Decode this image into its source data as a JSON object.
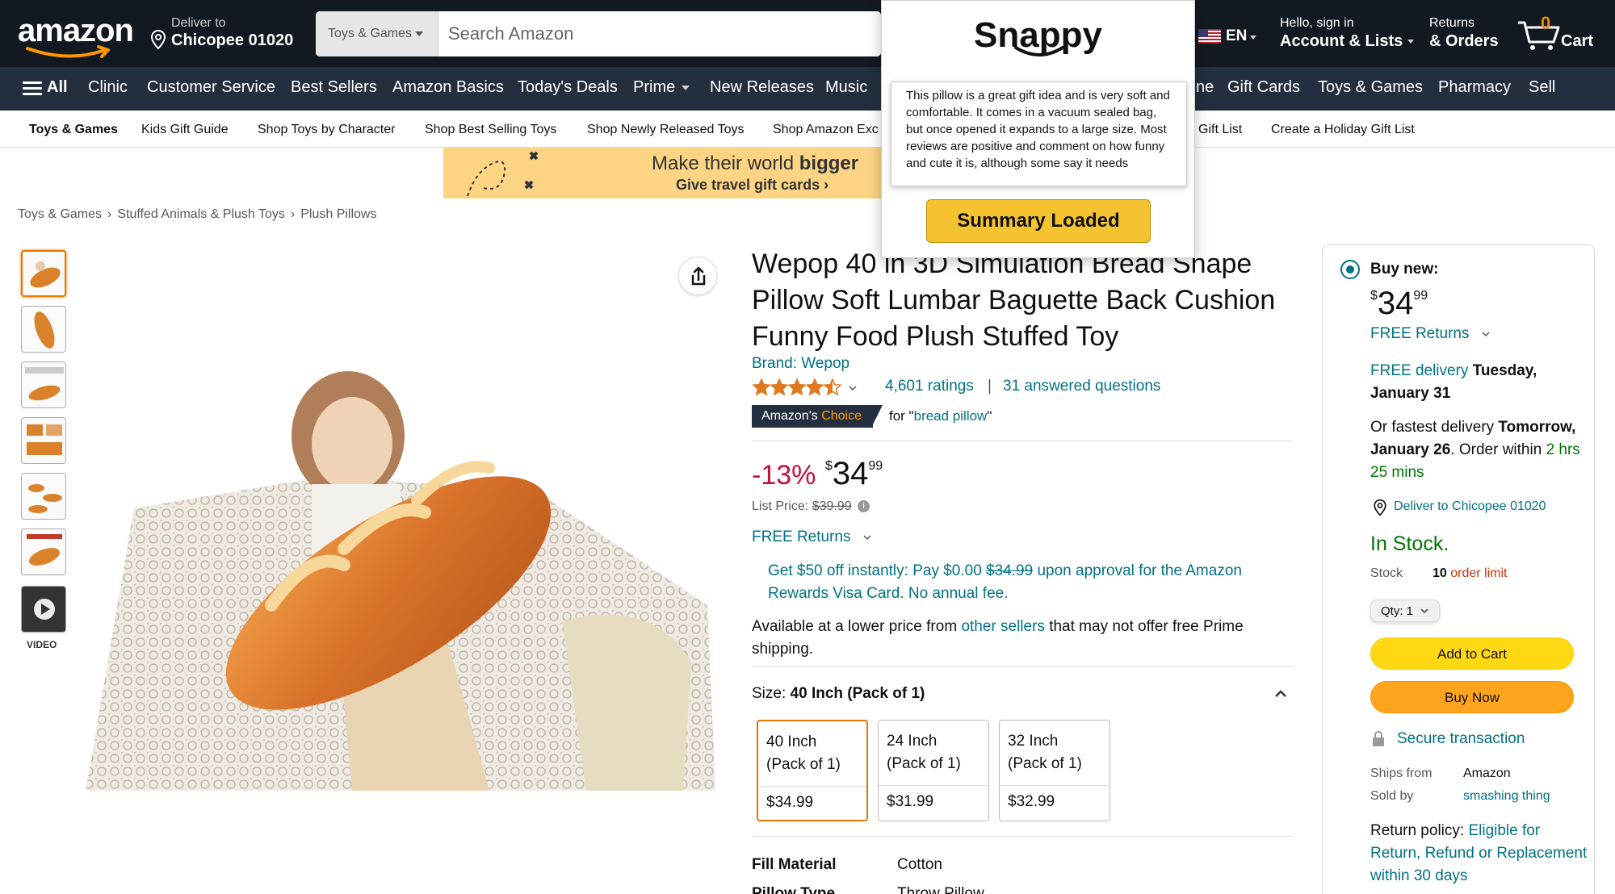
{
  "header": {
    "logo_text": "amazon",
    "deliver": {
      "line1": "Deliver to",
      "line2": "Chicopee 01020"
    },
    "search": {
      "category": "Toys & Games",
      "placeholder": "Search Amazon"
    },
    "language": "EN",
    "account": {
      "line1": "Hello, sign in",
      "line2": "Account & Lists"
    },
    "returns": {
      "line1": "Returns",
      "line2": "& Orders"
    },
    "cart": {
      "count": "0",
      "label": "Cart"
    }
  },
  "subnav": {
    "all_label": "All",
    "items": [
      "Clinic",
      "Customer Service",
      "Best Sellers",
      "Amazon Basics",
      "Today's Deals",
      "Prime",
      "New Releases",
      "Music",
      "ne",
      "Gift Cards",
      "Toys & Games",
      "Pharmacy",
      "Sell"
    ]
  },
  "catnav": {
    "items": [
      "Toys & Games",
      "Kids Gift Guide",
      "Shop Toys by Character",
      "Shop Best Selling Toys",
      "Shop Newly Released Toys",
      "Shop Amazon Exc",
      "Gift List",
      "Create a Holiday Gift List"
    ]
  },
  "banner": {
    "line1_pre": "Make their world ",
    "line1_bold": "bigger",
    "line2": "Give travel gift cards ›"
  },
  "breadcrumb": [
    "Toys & Games",
    "Stuffed Animals & Plush Toys",
    "Plush Pillows"
  ],
  "thumbnails": {
    "video_label": "VIDEO"
  },
  "product": {
    "title": "Wepop 40 in 3D Simulation Bread Shape Pillow Soft Lumbar Baguette Back Cushion Funny Food Plush Stuffed Toy",
    "brand": "Brand: Wepop",
    "rating": 4.5,
    "ratings_count": "4,601 ratings",
    "separator": "|",
    "answered": "31 answered questions",
    "choice_badge": {
      "pre": "Amazon's ",
      "highlight": "Choice"
    },
    "choice_for": {
      "pre": "for \"",
      "term": "bread pillow",
      "post": "\""
    },
    "discount": "-13%",
    "price": {
      "symbol": "$",
      "whole": "34",
      "fraction": "99"
    },
    "list_price": {
      "label": "List Price: ",
      "value": "$39.99"
    },
    "free_returns": "FREE Returns",
    "promo": {
      "pre": "Get $50 off instantly: Pay $0.00 ",
      "strike": "$34.99",
      "post": " upon approval for the Amazon Rewards Visa Card. No annual fee."
    },
    "lower_price": {
      "pre": "Available at a lower price from ",
      "link": "other sellers",
      "post": " that may not offer free Prime shipping."
    },
    "size": {
      "label": "Size: ",
      "selected": "40 Inch (Pack of 1)",
      "options": [
        {
          "line1": "40 Inch",
          "line2": "(Pack of 1)",
          "price": "$34.99"
        },
        {
          "line1": "24 Inch",
          "line2": "(Pack of 1)",
          "price": "$31.99"
        },
        {
          "line1": "32 Inch",
          "line2": "(Pack of 1)",
          "price": "$32.99"
        }
      ]
    },
    "details": [
      {
        "label": "Fill Material",
        "value": "Cotton"
      },
      {
        "label": "Pillow Type",
        "value": "Throw Pillow"
      }
    ]
  },
  "buybox": {
    "buy_new": "Buy new:",
    "price": {
      "symbol": "$",
      "whole": "34",
      "fraction": "99"
    },
    "free_returns": "FREE Returns",
    "delivery": {
      "link": "FREE delivery",
      "date": " Tuesday, January 31"
    },
    "fastest": {
      "pre": "Or fastest delivery ",
      "date": "Tomorrow, January 26",
      "mid": ". Order within ",
      "countdown": "2 hrs 25 mins"
    },
    "deliver_to": "Deliver to Chicopee 01020",
    "in_stock": "In Stock.",
    "stock_label": "Stock",
    "stock_value": "10",
    "stock_limit": " order limit",
    "qty": "Qty: 1",
    "add_to_cart": "Add to Cart",
    "buy_now": "Buy Now",
    "secure": "Secure transaction",
    "ships_from_label": "Ships from",
    "ships_from_value": "Amazon",
    "sold_by_label": "Sold by",
    "sold_by_value": "smashing thing",
    "return_policy": {
      "label": "Return policy: ",
      "link": "Eligible for Return, Refund or Replacement within 30 days"
    }
  },
  "snappy": {
    "logo": "Snappy",
    "summary": "This pillow is a great gift idea and is very soft and comfortable. It comes in a vacuum sealed bag, but once opened it expands to a large size. Most reviews are positive and comment on how funny and cute it is, although some say it needs",
    "button": "Summary Loaded"
  },
  "colors": {
    "nav_dark": "#131921",
    "nav_secondary": "#232f3e",
    "link": "#007185",
    "price_red": "#cc0c39",
    "stock_green": "#007600",
    "add_to_cart": "#ffd814",
    "buy_now": "#ffa41c",
    "snappy_button": "#f5c330"
  }
}
